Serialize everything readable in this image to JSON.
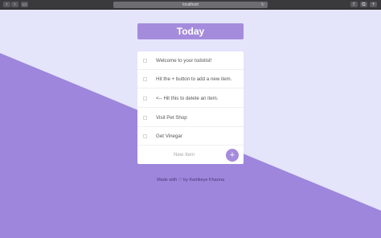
{
  "browser": {
    "url": "localhost",
    "back_icon": "chevron-left-icon",
    "forward_icon": "chevron-right-icon",
    "reload_icon": "reload-icon"
  },
  "colors": {
    "background_light": "#e4e4fb",
    "background_purple": "#9d86db",
    "accent": "#a58bdc"
  },
  "app": {
    "title": "Today",
    "items": [
      {
        "label": "Welcome to your todolist!",
        "checked": false
      },
      {
        "label": "Hit the + button to add a new item.",
        "checked": false
      },
      {
        "label": "<-- Hit this to delete an item.",
        "checked": false
      },
      {
        "label": "Visit Pet Shop",
        "checked": false
      },
      {
        "label": "Get Vinegar",
        "checked": false
      }
    ],
    "new_item_placeholder": "New Item",
    "add_button_label": "+"
  },
  "footer": {
    "made_with": "Made with",
    "heart": "♡",
    "author": "by Kartikeye Khanna"
  }
}
